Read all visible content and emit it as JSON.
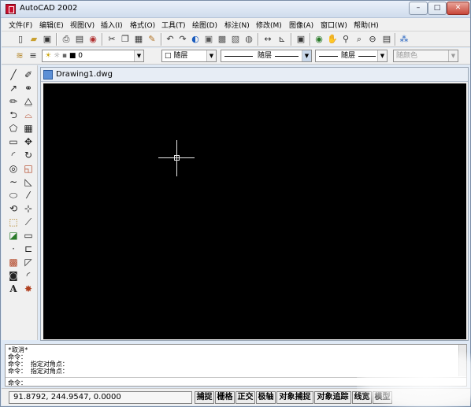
{
  "window": {
    "title": "AutoCAD 2002",
    "controls": {
      "minimize": "–",
      "maximize": "□",
      "close": "✕"
    }
  },
  "menu": [
    "文件(F)",
    "编辑(E)",
    "视图(V)",
    "插入(I)",
    "格式(O)",
    "工具(T)",
    "绘图(D)",
    "标注(N)",
    "修改(M)",
    "图像(A)",
    "窗口(W)",
    "帮助(H)"
  ],
  "toolbar_standard": {
    "icons": [
      "new-icon",
      "open-icon",
      "save-icon",
      "print-icon",
      "print-preview-icon",
      "plot-icon",
      "cut-icon",
      "copy-icon",
      "paste-icon",
      "match-properties-icon",
      "undo-icon",
      "redo-icon",
      "today-icon",
      "design-center-icon",
      "properties-icon",
      "tool-palette-icon",
      "dbconnect-icon",
      "distance-icon",
      "ucs-icon",
      "named-view-icon",
      "3dorbit-icon",
      "pan-icon",
      "zoom-realtime-icon",
      "zoom-window-icon",
      "zoom-previous-icon",
      "help-icon"
    ]
  },
  "toolbar_layers": {
    "layer_value": "0",
    "color_value": "随层",
    "linetype_value": "随层",
    "lineweight_value": "随层",
    "plotstyle_value": "随颜色"
  },
  "drawing": {
    "tab_title": "Drawing1.dwg",
    "background": "#000000",
    "cursor_color": "#e8e8e8"
  },
  "command": {
    "history": [
      "*取消*",
      "命令：",
      "命令： 指定对角点：",
      "命令： 指定对角点：",
      "命令："
    ]
  },
  "status": {
    "coords": "91.8792, 244.9547, 0.0000",
    "buttons": [
      "捕捉",
      "栅格",
      "正交",
      "极轴",
      "对象捕捉",
      "对象追踪",
      "线宽",
      "模型"
    ]
  }
}
